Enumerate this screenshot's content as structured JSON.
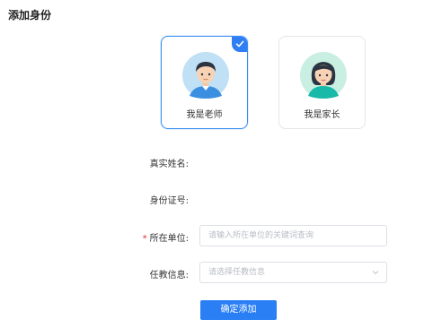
{
  "page": {
    "title": "添加身份"
  },
  "identity_cards": [
    {
      "label": "我是老师",
      "selected": true,
      "avatar_icon": "teacher-avatar-icon"
    },
    {
      "label": "我是家长",
      "selected": false,
      "avatar_icon": "parent-avatar-icon"
    }
  ],
  "form": {
    "name_label": "真实姓名:",
    "name_value": "",
    "id_label": "身份证号:",
    "id_value": "",
    "unit_label": "所在单位:",
    "unit_required_mark": "*",
    "unit_placeholder": "请输入所在单位的关键词查询",
    "teaching_label": "任教信息:",
    "teaching_placeholder": "请选择任教信息"
  },
  "actions": {
    "submit_label": "确定添加"
  },
  "colors": {
    "accent": "#2b7ff5",
    "required": "#e02b2b",
    "border": "#dcdfe6"
  }
}
